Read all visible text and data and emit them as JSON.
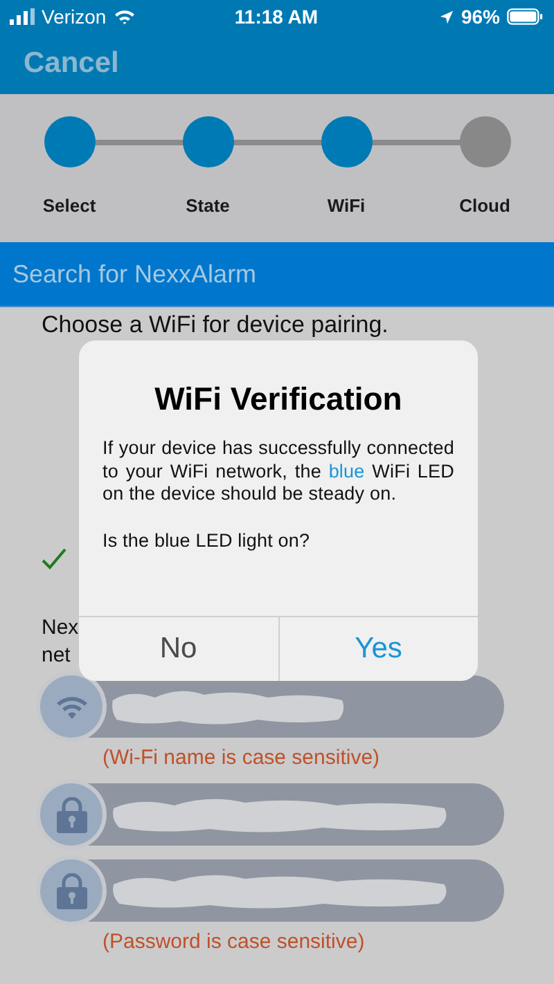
{
  "status_bar": {
    "carrier": "Verizon",
    "time": "11:18 AM",
    "battery": "96%"
  },
  "nav": {
    "cancel": "Cancel"
  },
  "steps": [
    {
      "label": "Select",
      "done": true
    },
    {
      "label": "State",
      "done": true
    },
    {
      "label": "WiFi",
      "done": true
    },
    {
      "label": "Cloud",
      "done": false
    }
  ],
  "search_bar": {
    "label": "Search for NexxAlarm"
  },
  "content": {
    "heading": "Choose a WiFi for device pairing.",
    "checked": true,
    "note_lines": [
      "Nex",
      "net"
    ]
  },
  "fields": [
    {
      "kind": "network",
      "redacted": true,
      "hint": "(Wi-Fi name is case sensitive)"
    },
    {
      "kind": "password",
      "redacted": true
    },
    {
      "kind": "password",
      "redacted": true,
      "hint": "(Password is case sensitive)"
    }
  ],
  "dialog": {
    "title": "WiFi Verification",
    "message": [
      {
        "text": "If your device has successfully connected to your WiFi network, the ",
        "highlight": false
      },
      {
        "text": "blue",
        "highlight": true
      },
      {
        "text": " WiFi LED on the device should be steady on.",
        "highlight": false
      }
    ],
    "question": "Is the blue LED light on?",
    "buttons": [
      {
        "label": "No",
        "primary": false
      },
      {
        "label": "Yes",
        "primary": true
      }
    ]
  }
}
